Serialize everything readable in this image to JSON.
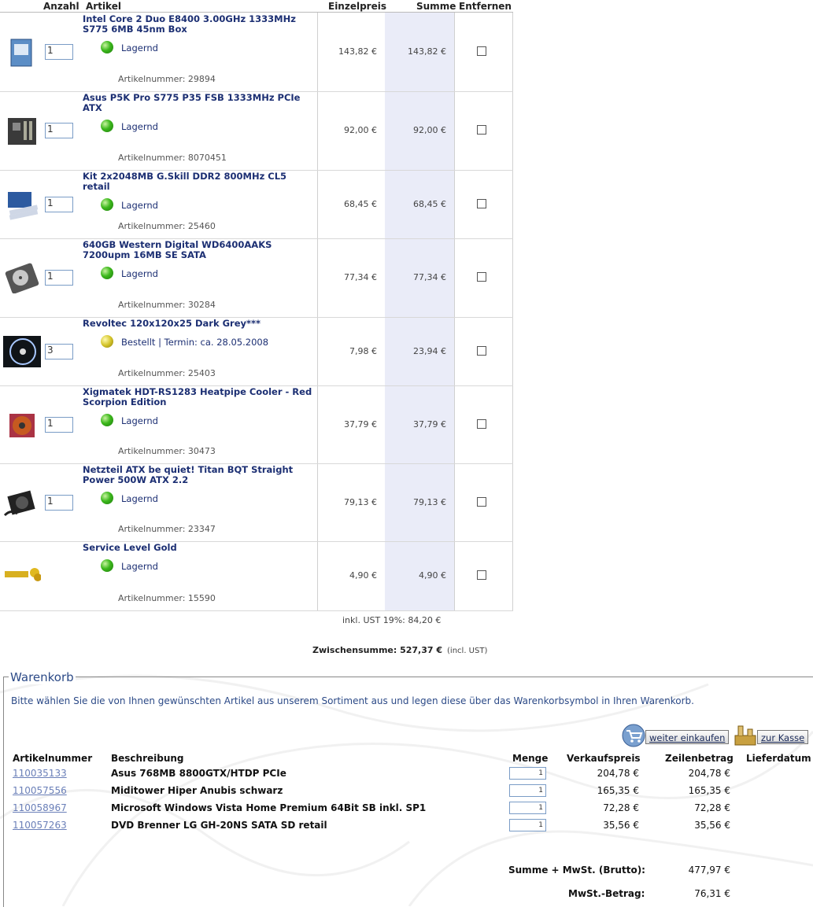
{
  "cart": {
    "headers": {
      "qty": "Anzahl",
      "article": "Artikel",
      "unit_price": "Einzelpreis",
      "sum": "Summe",
      "remove": "Entfernen"
    },
    "items": [
      {
        "title": "Intel Core 2 Duo E8400 3.00GHz 1333MHz S775 6MB 45nm Box",
        "qty": "1",
        "status": "Lagernd",
        "status_color": "green",
        "article_no": "Artikelnummer: 29894",
        "unit_price": "143,82 €",
        "sum": "143,82 €",
        "thumb_icon": "cpu-box-icon"
      },
      {
        "title": "Asus P5K Pro S775 P35 FSB 1333MHz PCIe ATX",
        "qty": "1",
        "status": "Lagernd",
        "status_color": "green",
        "article_no": "Artikelnummer: 8070451",
        "unit_price": "92,00 €",
        "sum": "92,00 €",
        "thumb_icon": "motherboard-icon"
      },
      {
        "title": "Kit 2x2048MB G.Skill DDR2 800MHz CL5 retail",
        "qty": "1",
        "status": "Lagernd",
        "status_color": "green",
        "article_no": "Artikelnummer: 25460",
        "unit_price": "68,45 €",
        "sum": "68,45 €",
        "thumb_icon": "ram-kit-icon"
      },
      {
        "title": "640GB Western Digital WD6400AAKS 7200upm 16MB SE SATA",
        "qty": "1",
        "status": "Lagernd",
        "status_color": "green",
        "article_no": "Artikelnummer: 30284",
        "unit_price": "77,34 €",
        "sum": "77,34 €",
        "thumb_icon": "hard-drive-icon"
      },
      {
        "title": "Revoltec 120x120x25 Dark Grey***",
        "qty": "3",
        "status": "Bestellt | Termin: ca. 28.05.2008",
        "status_color": "yellow",
        "article_no": "Artikelnummer: 25403",
        "unit_price": "7,98 €",
        "sum": "23,94 €",
        "thumb_icon": "case-fan-icon"
      },
      {
        "title": "Xigmatek HDT-RS1283 Heatpipe Cooler - Red Scorpion Edition",
        "qty": "1",
        "status": "Lagernd",
        "status_color": "green",
        "article_no": "Artikelnummer: 30473",
        "unit_price": "37,79 €",
        "sum": "37,79 €",
        "thumb_icon": "cpu-cooler-icon"
      },
      {
        "title": "Netzteil ATX be quiet! Titan BQT Straight Power 500W ATX 2.2",
        "qty": "1",
        "status": "Lagernd",
        "status_color": "green",
        "article_no": "Artikelnummer: 23347",
        "unit_price": "79,13 €",
        "sum": "79,13 €",
        "thumb_icon": "power-supply-icon"
      },
      {
        "title": "Service Level Gold",
        "qty": "",
        "status": "Lagernd",
        "status_color": "green",
        "article_no": "Artikelnummer: 15590",
        "unit_price": "4,90 €",
        "sum": "4,90 €",
        "thumb_icon": "service-gold-logo"
      }
    ],
    "tax_line": "inkl. UST 19%: 84,20 €",
    "subtotal_label": "Zwischensumme: 527,37 €",
    "subtotal_note": "(incl. UST)"
  },
  "warenkorb": {
    "legend": "Warenkorb",
    "info": "Bitte wählen Sie die von Ihnen gewünschten Artikel aus unserem Sortiment aus und legen diese über das Warenkorbsymbol in Ihren Warenkorb.",
    "continue_label": "weiter einkaufen",
    "checkout_label": "zur Kasse",
    "headers": {
      "artno": "Artikelnummer",
      "desc": "Beschreibung",
      "qty": "Menge",
      "price": "Verkaufspreis",
      "line": "Zeilenbetrag",
      "delivery": "Lieferdatum"
    },
    "rows": [
      {
        "artno": "110035133",
        "desc": "Asus 768MB 8800GTX/HTDP PCIe",
        "qty": "1",
        "price": "204,78 €",
        "line": "204,78 €"
      },
      {
        "artno": "110057556",
        "desc": "Miditower Hiper Anubis schwarz",
        "qty": "1",
        "price": "165,35 €",
        "line": "165,35 €"
      },
      {
        "artno": "110058967",
        "desc": "Microsoft Windows Vista Home Premium 64Bit SB inkl. SP1",
        "qty": "1",
        "price": "72,28 €",
        "line": "72,28 €"
      },
      {
        "artno": "110057263",
        "desc": "DVD Brenner LG GH-20NS SATA SD retail",
        "qty": "1",
        "price": "35,56 €",
        "line": "35,56 €"
      }
    ],
    "total_label": "Summe + MwSt. (Brutto):",
    "total_value": "477,97 €",
    "tax_label": "MwSt.-Betrag:",
    "tax_value": "76,31 €"
  },
  "colors": {
    "link": "#1c2f73",
    "sum_column": "#eaecf8",
    "legend": "#2c4a87"
  }
}
